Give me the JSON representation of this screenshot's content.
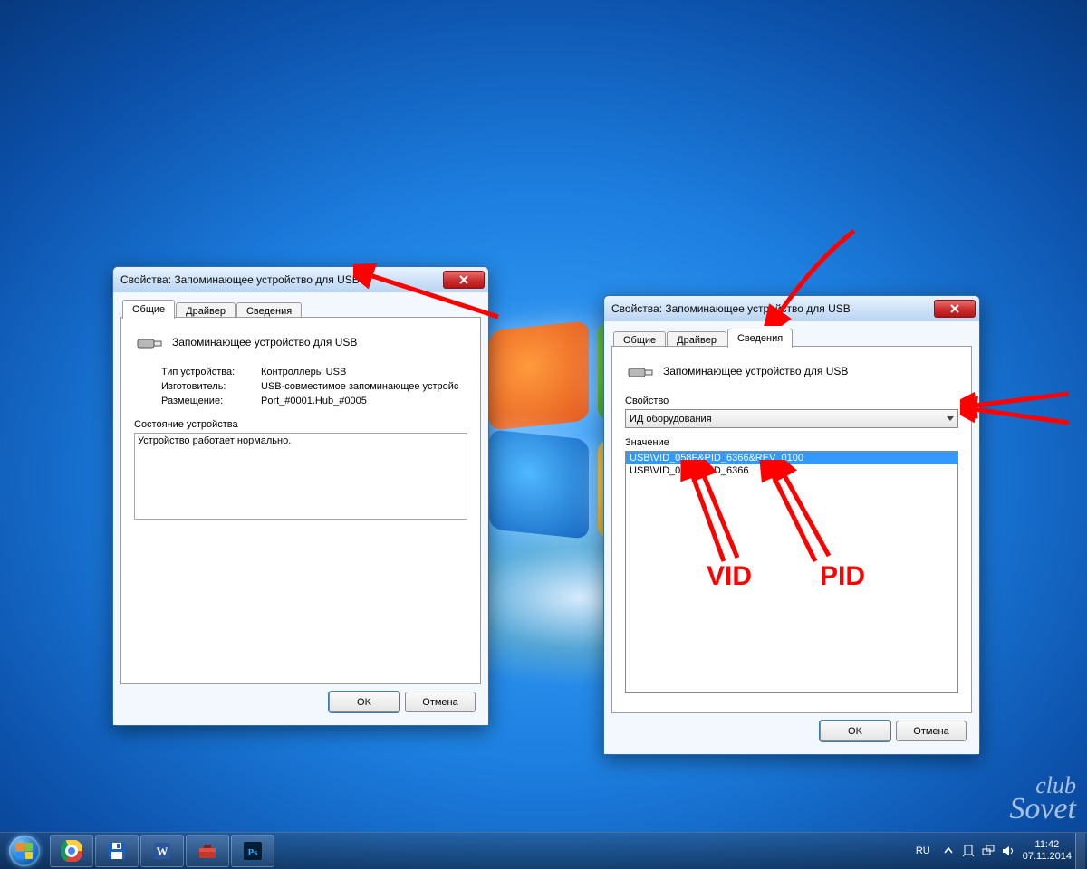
{
  "dialog1": {
    "title": "Свойства: Запоминающее устройство для USB",
    "tabs": [
      "Общие",
      "Драйвер",
      "Сведения"
    ],
    "active_tab": 0,
    "device_name": "Запоминающее устройство для USB",
    "rows": {
      "type_label": "Тип устройства:",
      "type_value": "Контроллеры USB",
      "mfr_label": "Изготовитель:",
      "mfr_value": "USB-совместимое запоминающее устройс",
      "loc_label": "Размещение:",
      "loc_value": "Port_#0001.Hub_#0005"
    },
    "status_label": "Состояние устройства",
    "status_text": "Устройство работает нормально.",
    "ok": "OK",
    "cancel": "Отмена"
  },
  "dialog2": {
    "title": "Свойства: Запоминающее устройство для USB",
    "tabs": [
      "Общие",
      "Драйвер",
      "Сведения"
    ],
    "active_tab": 2,
    "device_name": "Запоминающее устройство для USB",
    "property_label": "Свойство",
    "property_value": "ИД оборудования",
    "value_label": "Значение",
    "values": [
      "USB\\VID_058F&PID_6366&REV_0100",
      "USB\\VID_058F&PID_6366"
    ],
    "ok": "OK",
    "cancel": "Отмена"
  },
  "annotations": {
    "vid": "VID",
    "pid": "PID"
  },
  "watermark_top": "club",
  "watermark_bottom": "Sovet",
  "taskbar": {
    "lang": "RU",
    "time": "11:42",
    "date": "07.11.2014"
  }
}
